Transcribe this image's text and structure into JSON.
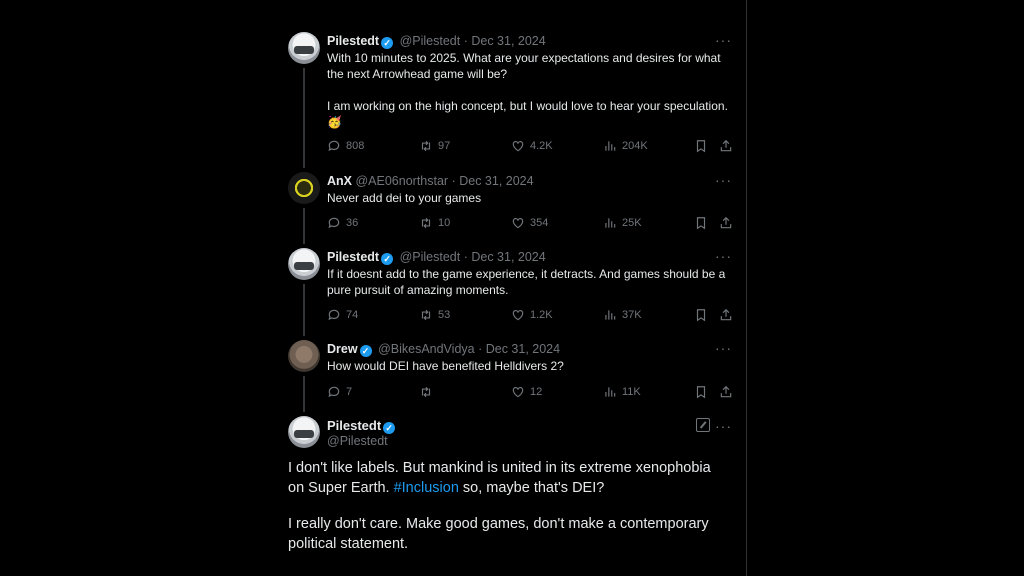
{
  "colors": {
    "background": "#000000",
    "text": "#e7e9ea",
    "muted": "#71767b",
    "accent": "#1d9bf0"
  },
  "tweets": [
    {
      "name": "Pilestedt",
      "handle": "@Pilestedt",
      "date": "· Dec 31, 2024",
      "more": "···",
      "text": "With 10 minutes to 2025. What are your expectations and desires for what the next Arrowhead game will be?\n\nI am working on the high concept, but I would love to hear your speculation.",
      "emoji": "🥳",
      "replies": "808",
      "reposts": "97",
      "likes": "4.2K",
      "views": "204K"
    },
    {
      "name": "AnX",
      "handle": "@AE06northstar",
      "date": "· Dec 31, 2024",
      "more": "···",
      "text": "Never add dei to your games",
      "replies": "36",
      "reposts": "10",
      "likes": "354",
      "views": "25K"
    },
    {
      "name": "Pilestedt",
      "handle": "@Pilestedt",
      "date": "· Dec 31, 2024",
      "more": "···",
      "text": "If it doesnt add to the game experience, it detracts. And games should be a pure pursuit of amazing moments.",
      "replies": "74",
      "reposts": "53",
      "likes": "1.2K",
      "views": "37K"
    },
    {
      "name": "Drew",
      "handle": "@BikesAndVidya",
      "date": "· Dec 31, 2024",
      "more": "···",
      "text": "How would DEI have benefited Helldivers 2?",
      "replies": "7",
      "reposts": "",
      "likes": "12",
      "views": "11K"
    }
  ],
  "main": {
    "name": "Pilestedt",
    "handle": "@Pilestedt",
    "more": "···",
    "line1a": "I don't like labels. But mankind is united in its extreme xenophobia on Super Earth. ",
    "hashtag": "#Inclusion",
    "line1b": " so, maybe that's DEI?",
    "line2": "I really don't care. Make good games, don't make a contemporary political statement."
  }
}
